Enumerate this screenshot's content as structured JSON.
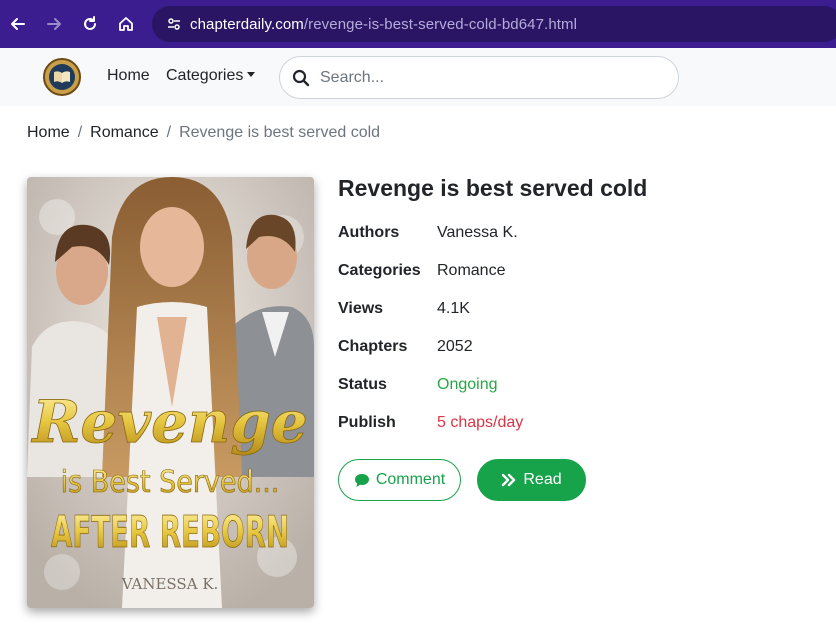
{
  "browser": {
    "url_domain": "chapterdaily.com",
    "url_path": "/revenge-is-best-served-cold-bd647.html"
  },
  "header": {
    "nav": {
      "home": "Home",
      "categories": "Categories"
    },
    "search": {
      "placeholder": "Search..."
    }
  },
  "breadcrumb": {
    "home": "Home",
    "category": "Romance",
    "current": "Revenge is best served cold"
  },
  "cover": {
    "title_line1": "Revenge",
    "title_line2": "is Best Served...",
    "title_line3": "AFTER REBORN",
    "author": "VANESSA K."
  },
  "book": {
    "title": "Revenge is best served cold",
    "info": [
      {
        "label": "Authors",
        "value": "Vanessa K."
      },
      {
        "label": "Categories",
        "value": "Romance"
      },
      {
        "label": "Views",
        "value": "4.1K"
      },
      {
        "label": "Chapters",
        "value": "2052"
      },
      {
        "label": "Status",
        "value": "Ongoing"
      },
      {
        "label": "Publish",
        "value": "5 chaps/day"
      }
    ],
    "comment_label": "Comment",
    "read_label": "Read"
  },
  "colors": {
    "browser_chrome": "#3b1d8f",
    "accent_green": "#16a34a",
    "status_green": "#28a745",
    "publish_red": "#dc3545"
  }
}
